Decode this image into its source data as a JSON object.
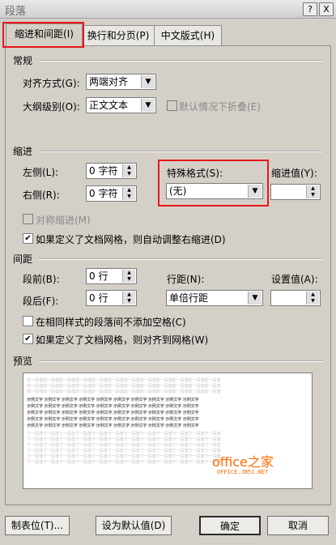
{
  "window": {
    "title": "段落",
    "help_label": "?",
    "close_label": "X"
  },
  "tabs": [
    {
      "label": "缩进和间距(I)",
      "active": true
    },
    {
      "label": "换行和分页(P)",
      "active": false
    },
    {
      "label": "中文版式(H)",
      "active": false
    }
  ],
  "general": {
    "title": "常规",
    "alignment_label": "对齐方式(G):",
    "alignment_value": "两端对齐",
    "outline_label": "大纲级别(O):",
    "outline_value": "正文文本",
    "collapse_label": "默认情况下折叠(E)"
  },
  "indent": {
    "title": "缩进",
    "left_label": "左侧(L):",
    "left_value": "0 字符",
    "right_label": "右侧(R):",
    "right_value": "0 字符",
    "special_label": "特殊格式(S):",
    "special_value": "(无)",
    "indent_value_label": "缩进值(Y):",
    "indent_value": "",
    "mirror_label": "对称缩进(M)",
    "auto_adjust_label": "如果定义了文档网格，则自动调整右缩进(D)",
    "auto_adjust_checked": true
  },
  "spacing": {
    "title": "间距",
    "before_label": "段前(B):",
    "before_value": "0 行",
    "after_label": "段后(F):",
    "after_value": "0 行",
    "line_spacing_label": "行距(N):",
    "line_spacing_value": "单倍行距",
    "at_label": "设置值(A):",
    "at_value": "",
    "no_space_same_style_label": "在相同样式的段落间不添加空格(C)",
    "no_space_same_style_checked": false,
    "snap_grid_label": "如果定义了文档网格，则对齐到网格(W)",
    "snap_grid_checked": true
  },
  "preview": {
    "title": "预览",
    "prev_paragraph": "前一段落前一段落前一段落前一段落前一段落前一段落前一段落前一段落前一段落前一段落前一段落前一段落",
    "sample_text": "示例文字 示例文字 示例文字 示例文字 示例文字 示例文字 示例文字 示例文字 示例文字 示例文字",
    "next_paragraph": "下一段落下一段落下一段落下一段落下一段落下一段落下一段落下一段落下一段落下一段落下一段落下一段落",
    "watermark": "office之家",
    "watermark_sub": "OFFICE.JB51.NET"
  },
  "buttons": {
    "tabs_label": "制表位(T)...",
    "default_label": "设为默认值(D)",
    "ok_label": "确定",
    "cancel_label": "取消"
  },
  "colors": {
    "highlight_red": "#e8161b",
    "dialog_bg": "#d4d0c8",
    "watermark_orange": "#ff6a00"
  }
}
